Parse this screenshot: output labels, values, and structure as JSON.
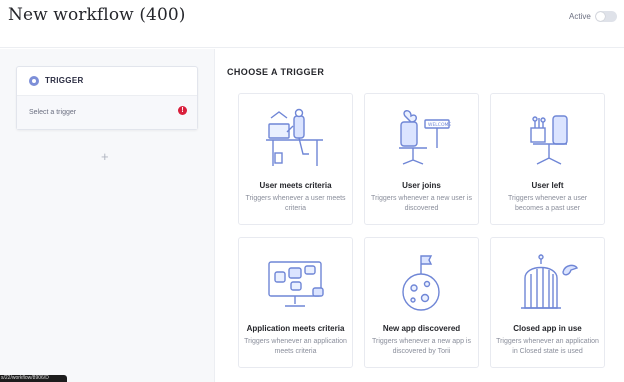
{
  "header": {
    "title": "New workflow (400)",
    "active_label": "Active",
    "active_on": false
  },
  "left": {
    "trigger_label": "TRIGGER",
    "select_placeholder": "Select a trigger",
    "error_glyph": "!",
    "add_glyph": "+"
  },
  "main": {
    "section_title": "CHOOSE A TRIGGER",
    "cards": [
      {
        "title": "User meets criteria",
        "desc": "Triggers whenever a user meets criteria",
        "icon": "desk-worker-illustration"
      },
      {
        "title": "User joins",
        "desc": "Triggers whenever a new user is discovered",
        "icon": "welcome-chair-illustration"
      },
      {
        "title": "User left",
        "desc": "Triggers whenever a user becomes a past user",
        "icon": "empty-chair-illustration"
      },
      {
        "title": "Application meets criteria",
        "desc": "Triggers whenever an application meets criteria",
        "icon": "monitor-apps-illustration"
      },
      {
        "title": "New app discovered",
        "desc": "Triggers whenever a new app is discovered by Torii",
        "icon": "planet-flag-illustration"
      },
      {
        "title": "Closed app in use",
        "desc": "Triggers whenever an application in Closed state is used",
        "icon": "bird-cage-illustration"
      }
    ]
  },
  "status_bar": {
    "url": "s/22/workflow/8906/D"
  },
  "colors": {
    "accent": "#7d8fd8",
    "error": "#d91f3c",
    "illustration": "#6f86d6"
  }
}
